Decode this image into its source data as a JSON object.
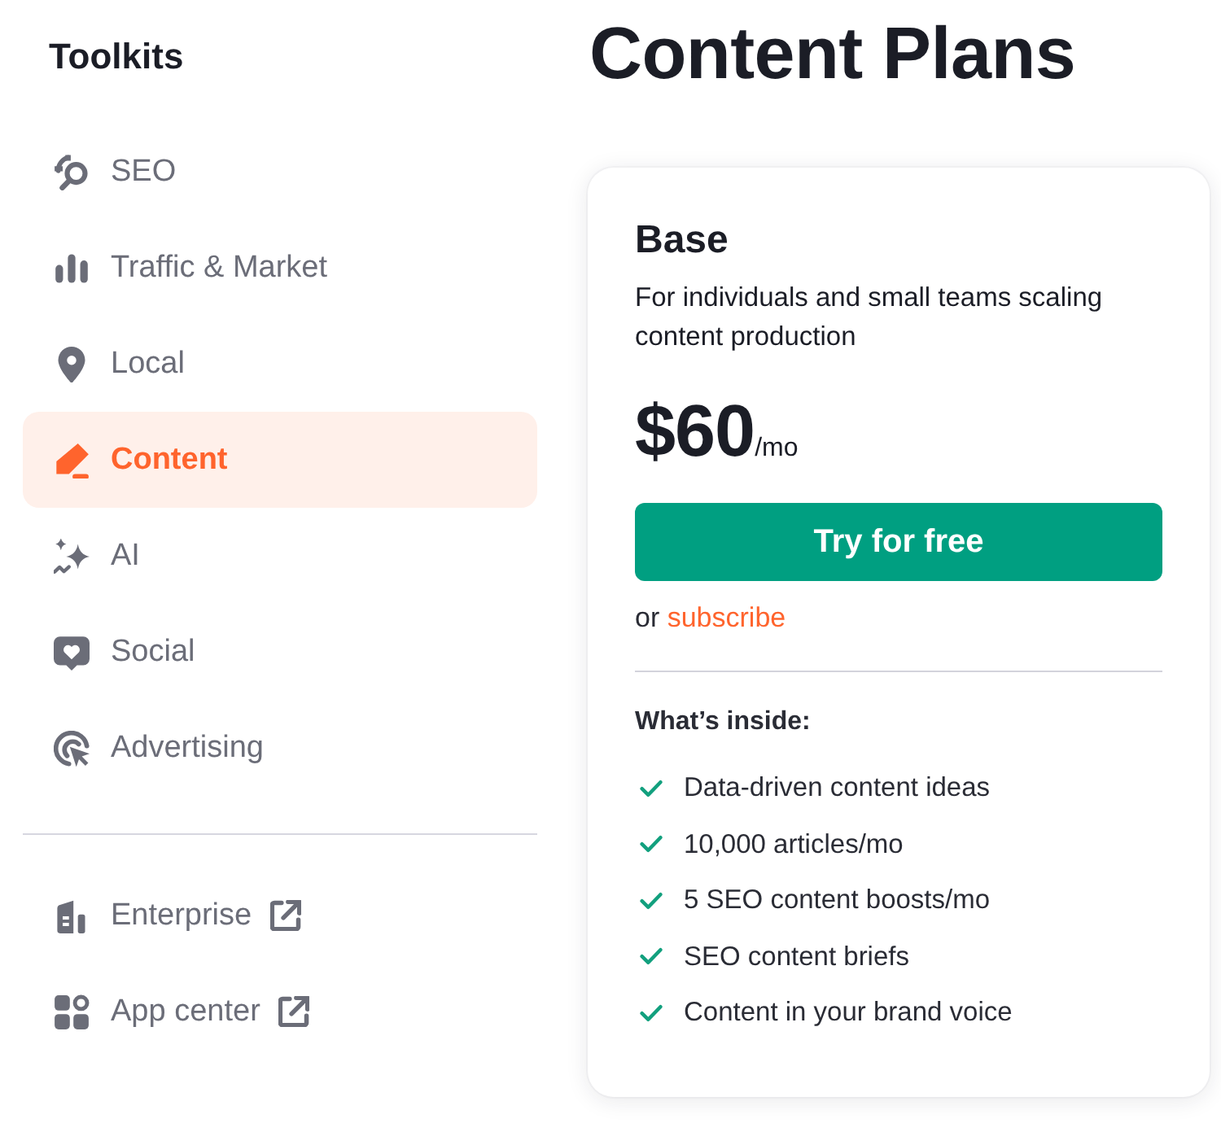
{
  "sidebar": {
    "title": "Toolkits",
    "items": [
      {
        "label": "SEO",
        "selected": false
      },
      {
        "label": "Traffic & Market",
        "selected": false
      },
      {
        "label": "Local",
        "selected": false
      },
      {
        "label": "Content",
        "selected": true
      },
      {
        "label": "AI",
        "selected": false
      },
      {
        "label": "Social",
        "selected": false
      },
      {
        "label": "Advertising",
        "selected": false
      }
    ],
    "links": [
      {
        "label": "Enterprise"
      },
      {
        "label": "App center"
      }
    ]
  },
  "page_title": "Content Plans",
  "plan": {
    "name": "Base",
    "description": "For individuals and small teams scaling content production",
    "price": "$60",
    "period": "/mo",
    "cta": "Try for free",
    "alt_text": "or",
    "alt_link": "subscribe",
    "features_heading": "What’s inside:",
    "features": [
      "Data-driven content ideas",
      "10,000 articles/mo",
      "5 SEO content boosts/mo",
      "SEO content briefs",
      "Content in your brand voice"
    ]
  }
}
